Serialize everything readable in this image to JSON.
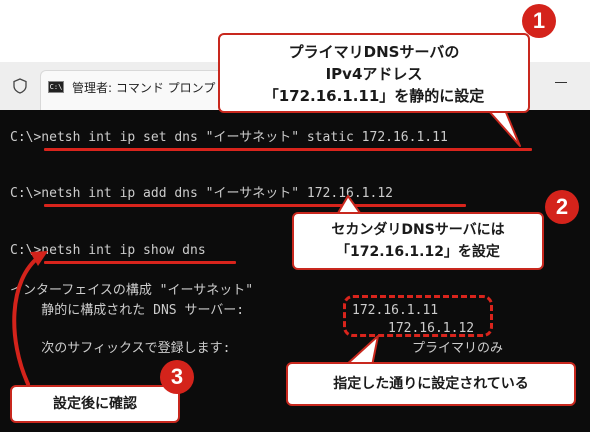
{
  "window": {
    "tab_title": "管理者: コマンド プロンプト",
    "tab_icon_text": "C:\\"
  },
  "terminal": {
    "line1": "C:\\>netsh int ip set dns \"イーサネット\" static 172.16.1.11",
    "line2": "C:\\>netsh int ip add dns \"イーサネット\" 172.16.1.12",
    "line3": "C:\\>netsh int ip show dns",
    "line4": "インターフェイスの構成 \"イーサネット\"",
    "line5": "    静的に構成された DNS サーバー:",
    "dns_primary": "172.16.1.11",
    "dns_secondary": "172.16.1.12",
    "line6": "    次のサフィックスで登録します:",
    "suffix_value": "プライマリのみ"
  },
  "callouts": {
    "c1": {
      "badge": "1",
      "line1": "プライマリDNSサーバの",
      "line2": "IPv4アドレス",
      "line3": "「172.16.1.11」を静的に設定"
    },
    "c2": {
      "badge": "2",
      "line1": "セカンダリDNSサーバには",
      "line2": "「172.16.1.12」を設定"
    },
    "c3": {
      "badge": "3",
      "line1": "設定後に確認"
    },
    "c4": {
      "line1": "指定した通りに設定されている"
    }
  },
  "colors": {
    "accent_red": "#d4231b",
    "terminal_bg": "#0c0c0c",
    "terminal_text": "#cccccc"
  }
}
